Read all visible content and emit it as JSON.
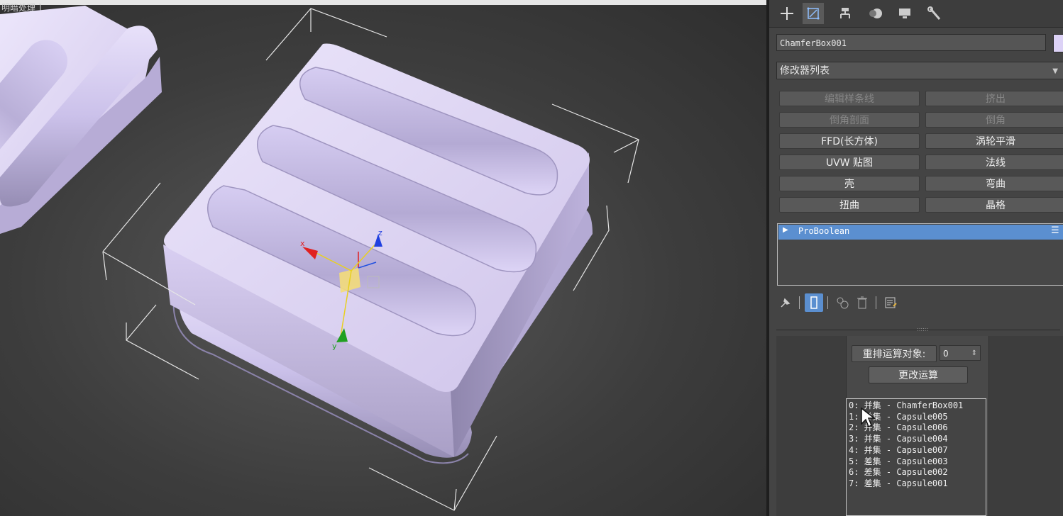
{
  "viewport": {
    "label": "明暗处理 ]"
  },
  "command_panel": {
    "tabs": [
      {
        "name": "create",
        "icon": "plus-icon"
      },
      {
        "name": "modify",
        "icon": "modify-icon"
      },
      {
        "name": "hierarchy",
        "icon": "hierarchy-icon"
      },
      {
        "name": "motion",
        "icon": "motion-icon"
      },
      {
        "name": "display",
        "icon": "display-icon"
      },
      {
        "name": "utilities",
        "icon": "wrench-icon"
      }
    ],
    "object_name": "ChamferBox001",
    "object_color": "#dcd2f6",
    "modifier_list_label": "修改器列表",
    "modifier_buttons": [
      {
        "label": "编辑样条线",
        "enabled": false
      },
      {
        "label": "挤出",
        "enabled": false
      },
      {
        "label": "倒角剖面",
        "enabled": false
      },
      {
        "label": "倒角",
        "enabled": false
      },
      {
        "label": "FFD(长方体)",
        "enabled": true
      },
      {
        "label": "涡轮平滑",
        "enabled": true
      },
      {
        "label": "UVW 贴图",
        "enabled": true
      },
      {
        "label": "法线",
        "enabled": true
      },
      {
        "label": "壳",
        "enabled": true
      },
      {
        "label": "弯曲",
        "enabled": true
      },
      {
        "label": "扭曲",
        "enabled": true
      },
      {
        "label": "晶格",
        "enabled": true
      }
    ],
    "stack_items": [
      "ProBoolean"
    ],
    "reorder": {
      "label": "重排运算对象:",
      "value": "0"
    },
    "change_op_label": "更改运算",
    "operands": [
      "0: 并集 - ChamferBox001",
      "1: 并集 - Capsule005",
      "2: 并集 - Capsule006",
      "3: 并集 - Capsule004",
      "4: 并集 - Capsule007",
      "5: 差集 - Capsule003",
      "6: 差集 - Capsule002",
      "7: 差集 - Capsule001"
    ],
    "highlight_color": "#e8201c",
    "accent_color": "#5b8fd0"
  }
}
